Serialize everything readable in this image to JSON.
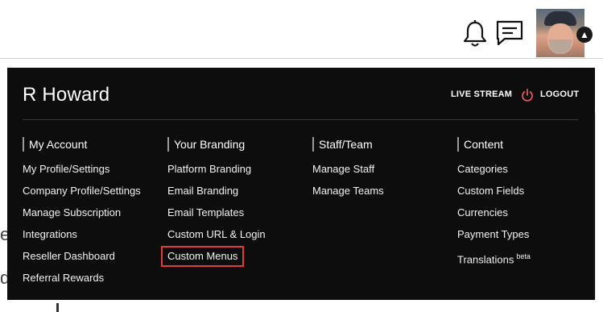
{
  "user": {
    "name": "R Howard"
  },
  "top_links": {
    "live_stream": "LIVE STREAM",
    "logout": "LOGOUT"
  },
  "colors": {
    "panel_bg": "#0d0d0d",
    "highlight": "#e23b3b",
    "logout_icon": "#e05a5a"
  },
  "icons": {
    "notifications": "bell-icon",
    "messages": "chat-icon",
    "profile": "avatar",
    "toggle": "chevron-up-icon",
    "logout": "power-icon"
  },
  "columns": [
    {
      "title": "My Account",
      "items": [
        {
          "label": "My Profile/Settings"
        },
        {
          "label": "Company Profile/Settings"
        },
        {
          "label": "Manage Subscription"
        },
        {
          "label": "Integrations"
        },
        {
          "label": "Reseller Dashboard"
        },
        {
          "label": "Referral Rewards"
        }
      ]
    },
    {
      "title": "Your Branding",
      "items": [
        {
          "label": "Platform Branding"
        },
        {
          "label": "Email Branding"
        },
        {
          "label": "Email Templates"
        },
        {
          "label": "Custom URL & Login"
        },
        {
          "label": "Custom Menus"
        }
      ]
    },
    {
      "title": "Staff/Team",
      "items": [
        {
          "label": "Manage Staff"
        },
        {
          "label": "Manage Teams"
        }
      ]
    },
    {
      "title": "Content",
      "items": [
        {
          "label": "Categories"
        },
        {
          "label": "Custom Fields"
        },
        {
          "label": "Currencies"
        },
        {
          "label": "Payment Types"
        },
        {
          "label": "Translations",
          "badge": "beta"
        }
      ]
    }
  ]
}
